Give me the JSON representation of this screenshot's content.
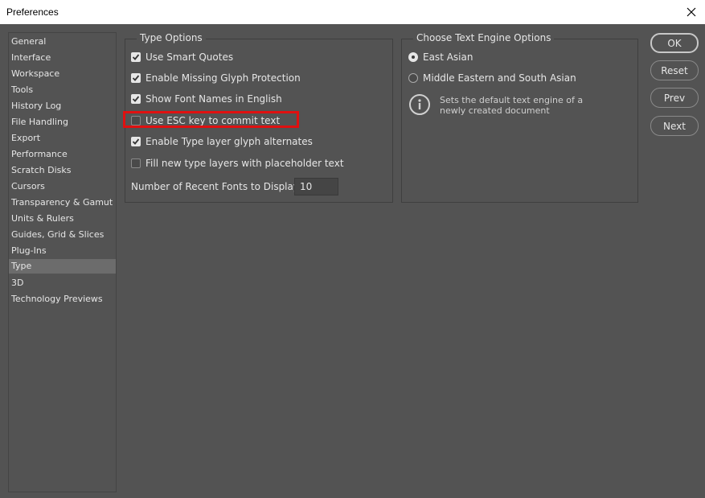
{
  "window": {
    "title": "Preferences"
  },
  "sidebar": {
    "items": [
      {
        "label": "General"
      },
      {
        "label": "Interface"
      },
      {
        "label": "Workspace"
      },
      {
        "label": "Tools"
      },
      {
        "label": "History Log"
      },
      {
        "label": "File Handling"
      },
      {
        "label": "Export"
      },
      {
        "label": "Performance"
      },
      {
        "label": "Scratch Disks"
      },
      {
        "label": "Cursors"
      },
      {
        "label": "Transparency & Gamut"
      },
      {
        "label": "Units & Rulers"
      },
      {
        "label": "Guides, Grid & Slices"
      },
      {
        "label": "Plug-Ins"
      },
      {
        "label": "Type",
        "selected": true
      },
      {
        "label": "3D"
      },
      {
        "label": "Technology Previews"
      }
    ]
  },
  "type_options": {
    "legend": "Type Options",
    "options": [
      {
        "label": "Use Smart Quotes",
        "checked": true
      },
      {
        "label": "Enable Missing Glyph Protection",
        "checked": true
      },
      {
        "label": "Show Font Names in English",
        "checked": true
      },
      {
        "label": "Use ESC key to commit text",
        "checked": false,
        "highlighted": true
      },
      {
        "label": "Enable Type layer glyph alternates",
        "checked": true
      },
      {
        "label": "Fill new type layers with placeholder text",
        "checked": false
      }
    ],
    "recent_fonts_label": "Number of Recent Fonts to Display:",
    "recent_fonts_value": "10"
  },
  "text_engine": {
    "legend": "Choose Text Engine Options",
    "options": [
      {
        "label": "East Asian",
        "selected": true
      },
      {
        "label": "Middle Eastern and South Asian",
        "selected": false
      }
    ],
    "info_line1": "Sets the default text engine of a",
    "info_line2": "newly created document"
  },
  "buttons": {
    "ok": "OK",
    "reset": "Reset",
    "prev": "Prev",
    "next": "Next"
  },
  "colors": {
    "panel_bg": "#535353",
    "selected_item_bg": "#6c6c6c",
    "highlight_border": "#e01010"
  }
}
